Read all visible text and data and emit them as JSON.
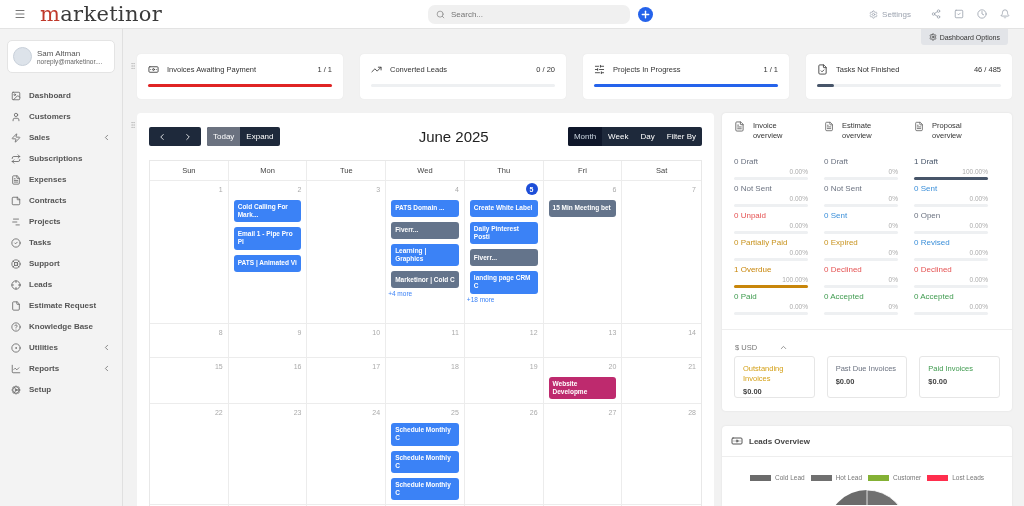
{
  "topbar": {
    "logo": "marketinor",
    "search": {
      "placeholder": "Search..."
    },
    "settings": "Settings"
  },
  "user": {
    "name": "Sam Altman",
    "email": "noreply@marketinor...."
  },
  "sidebar": {
    "items": [
      {
        "label": "Dashboard",
        "has_submenu": false
      },
      {
        "label": "Customers",
        "has_submenu": false
      },
      {
        "label": "Sales",
        "has_submenu": true
      },
      {
        "label": "Subscriptions",
        "has_submenu": false
      },
      {
        "label": "Expenses",
        "has_submenu": false
      },
      {
        "label": "Contracts",
        "has_submenu": false
      },
      {
        "label": "Projects",
        "has_submenu": false
      },
      {
        "label": "Tasks",
        "has_submenu": false
      },
      {
        "label": "Support",
        "has_submenu": false
      },
      {
        "label": "Leads",
        "has_submenu": false
      },
      {
        "label": "Estimate Request",
        "has_submenu": false
      },
      {
        "label": "Knowledge Base",
        "has_submenu": false
      },
      {
        "label": "Utilities",
        "has_submenu": true
      },
      {
        "label": "Reports",
        "has_submenu": true
      },
      {
        "label": "Setup",
        "has_submenu": false
      }
    ]
  },
  "dashboard_options": "Dashboard Options",
  "stats": [
    {
      "title": "Invoices Awaiting Payment",
      "count": "1 / 1",
      "level": 1,
      "color": "#e02424"
    },
    {
      "title": "Converted Leads",
      "count": "0 / 20",
      "level": 0
    },
    {
      "title": "Projects In Progress",
      "count": "1 / 1",
      "level": 1,
      "color": "#2563eb"
    },
    {
      "title": "Tasks Not Finished",
      "count": "46 / 485",
      "level": 0.095,
      "color": "#475569"
    }
  ],
  "calendar": {
    "title": "June 2025",
    "nav": {
      "today": "Today",
      "expand": "Expand"
    },
    "views": [
      {
        "label": "Month",
        "selected": true
      },
      {
        "label": "Week",
        "selected": false
      },
      {
        "label": "Day",
        "selected": false
      },
      {
        "label": "Filter By",
        "selected": false
      }
    ],
    "weekdays": [
      "Sun",
      "Mon",
      "Tue",
      "Wed",
      "Thu",
      "Fri",
      "Sat"
    ],
    "weeks": [
      [
        {
          "day": "1",
          "today": false
        },
        {
          "day": "2",
          "today": false,
          "events": [
            {
              "title": "Cold Calling For Mark...",
              "color": "#3b82f6"
            },
            {
              "title": "Email 1 - Pipe Pro Pl",
              "color": "#3b82f6"
            },
            {
              "title": "PATS | Animated Vi",
              "color": "#3b82f6"
            }
          ]
        },
        {
          "day": "3",
          "today": false
        },
        {
          "day": "4",
          "today": false,
          "events": [
            {
              "title": "PATS Domain ...",
              "color": "#3b82f6"
            },
            {
              "title": "Fiverr...",
              "color": "#64748b"
            },
            {
              "title": "Learning | Graphics",
              "color": "#3b82f6"
            },
            {
              "title": "Marketinor | Cold C",
              "color": "#64748b"
            }
          ],
          "more": "+4 more"
        },
        {
          "day": "5",
          "today": true,
          "events": [
            {
              "title": "Create White Label",
              "color": "#3b82f6"
            },
            {
              "title": "Daily Pinterest Posti",
              "color": "#3b82f6"
            },
            {
              "title": "Fiverr...",
              "color": "#64748b"
            },
            {
              "title": "landing page CRM C",
              "color": "#3b82f6"
            }
          ],
          "more": "+18 more"
        },
        {
          "day": "6",
          "today": false,
          "events": [
            {
              "title": "15 Min Meeting bet",
              "color": "#64748b"
            }
          ]
        },
        {
          "day": "7",
          "today": false
        }
      ],
      [
        {
          "day": "8",
          "today": false
        },
        {
          "day": "9",
          "today": false
        },
        {
          "day": "10",
          "today": false
        },
        {
          "day": "11",
          "today": false
        },
        {
          "day": "12",
          "today": false
        },
        {
          "day": "13",
          "today": false
        },
        {
          "day": "14",
          "today": false
        }
      ],
      [
        {
          "day": "15",
          "today": false
        },
        {
          "day": "16",
          "today": false
        },
        {
          "day": "17",
          "today": false
        },
        {
          "day": "18",
          "today": false
        },
        {
          "day": "19",
          "today": false
        },
        {
          "day": "20",
          "today": false,
          "events": [
            {
              "title": "Website Developme",
              "color": "#be2a6e"
            }
          ]
        },
        {
          "day": "21",
          "today": false
        }
      ],
      [
        {
          "day": "22",
          "today": false
        },
        {
          "day": "23",
          "today": false
        },
        {
          "day": "24",
          "today": false
        },
        {
          "day": "25",
          "today": false,
          "events": [
            {
              "title": "Schedule Monthly C",
              "color": "#3b82f6"
            },
            {
              "title": "Schedule Monthly C",
              "color": "#3b82f6"
            },
            {
              "title": "Schedule Monthly C",
              "color": "#3b82f6"
            }
          ]
        },
        {
          "day": "26",
          "today": false
        },
        {
          "day": "27",
          "today": false
        },
        {
          "day": "28",
          "today": false
        }
      ]
    ]
  },
  "overview": {
    "columns": [
      {
        "title": "Invoice overview",
        "rows": [
          {
            "label": "0 Draft",
            "percent": "0.00%",
            "level": 0,
            "kind": "draft"
          },
          {
            "label": "0 Not Sent",
            "percent": "0.00%",
            "level": 0,
            "kind": "not_sent"
          },
          {
            "label": "0 Unpaid",
            "percent": "0.00%",
            "level": 0,
            "kind": "unpaid"
          },
          {
            "label": "0 Partially Paid",
            "percent": "0.00%",
            "level": 0,
            "kind": "partially_paid"
          },
          {
            "label": "1 Overdue",
            "percent": "100.00%",
            "level": 1,
            "kind": "overdue"
          },
          {
            "label": "0 Paid",
            "percent": "0.00%",
            "level": 0,
            "kind": "paid"
          }
        ]
      },
      {
        "title": "Estimate overview",
        "rows": [
          {
            "label": "0 Draft",
            "percent": "0%",
            "level": 0,
            "kind": "draft"
          },
          {
            "label": "0 Not Sent",
            "percent": "0%",
            "level": 0,
            "kind": "not_sent"
          },
          {
            "label": "0 Sent",
            "percent": "0%",
            "level": 0,
            "kind": "sent"
          },
          {
            "label": "0 Expired",
            "percent": "0%",
            "level": 0,
            "kind": "expired"
          },
          {
            "label": "0 Declined",
            "percent": "0%",
            "level": 0,
            "kind": "declined"
          },
          {
            "label": "0 Accepted",
            "percent": "0%",
            "level": 0,
            "kind": "accepted"
          }
        ]
      },
      {
        "title": "Proposal overview",
        "rows": [
          {
            "label": "1 Draft",
            "percent": "100.00%",
            "level": 1,
            "kind": "draft"
          },
          {
            "label": "0 Sent",
            "percent": "0.00%",
            "level": 0,
            "kind": "sent"
          },
          {
            "label": "0 Open",
            "percent": "0.00%",
            "level": 0,
            "kind": "open"
          },
          {
            "label": "0 Revised",
            "percent": "0.00%",
            "level": 0,
            "kind": "revised"
          },
          {
            "label": "0 Declined",
            "percent": "0.00%",
            "level": 0,
            "kind": "declined"
          },
          {
            "label": "0 Accepted",
            "percent": "0.00%",
            "level": 0,
            "kind": "accepted"
          }
        ]
      }
    ],
    "currency": "$ USD",
    "totals": [
      {
        "title": "Outstanding Invoices",
        "amount": "$0.00",
        "kind": "outstanding"
      },
      {
        "title": "Past Due Invoices",
        "amount": "$0.00",
        "kind": "past_due"
      },
      {
        "title": "Paid Invoices",
        "amount": "$0.00",
        "kind": "paid"
      }
    ]
  },
  "leads": {
    "title": "Leads Overview",
    "legend": [
      {
        "label": "Cold Lead",
        "color": "#6b6b6b"
      },
      {
        "label": "Hot Lead",
        "color": "#707070"
      },
      {
        "label": "Customer",
        "color": "#84b135"
      },
      {
        "label": "Lost Leads",
        "color": "#ff2e4d"
      }
    ]
  }
}
